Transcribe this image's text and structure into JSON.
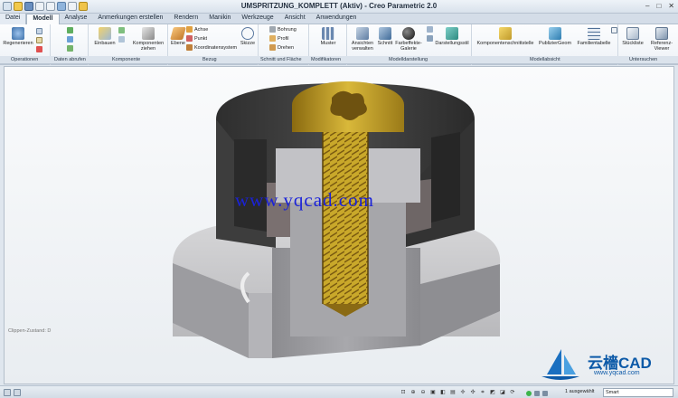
{
  "window": {
    "title": "UMSPRITZUNG_KOMPLETT (Aktiv) - Creo Parametric 2.0",
    "controls": [
      "–",
      "□",
      "✕"
    ]
  },
  "tabs": [
    {
      "label": "Datei",
      "kind": "file"
    },
    {
      "label": "Modell",
      "active": true
    },
    {
      "label": "Analyse"
    },
    {
      "label": "Anmerkungen erstellen"
    },
    {
      "label": "Rendern"
    },
    {
      "label": "Manikin"
    },
    {
      "label": "Werkzeuge"
    },
    {
      "label": "Ansicht"
    },
    {
      "label": "Anwendungen"
    }
  ],
  "ribbon": {
    "operationen": {
      "regenerieren": "Regenerieren",
      "footer": "Operationen"
    },
    "daten": {
      "footer": "Daten abrufen"
    },
    "komponente": {
      "einbauen": "Einbauen",
      "ziehen": "Komponenten ziehen",
      "footer": "Komponente"
    },
    "bezug": {
      "ebene": "Ebene",
      "achse": "Achse",
      "punkt": "Punkt",
      "koordinatensystem": "Koordinatensystem",
      "skizze": "Skizze",
      "footer": "Bezug"
    },
    "schnitt": {
      "bohrung": "Bohrung",
      "profil": "Profil",
      "drehen": "Drehen",
      "footer": "Schnitt und Fläche"
    },
    "modifikatoren": {
      "muster": "Muster",
      "footer": "Modifikatoren"
    },
    "darstellung": {
      "ansichten": "Ansichten verwalten",
      "schnitt": "Schnitt",
      "farbeffekte": "Farbeffekte-Galerie",
      "darstellungsstil": "Darstellungsstil",
      "footer": "Modelldarstellung"
    },
    "absicht": {
      "komponentenschnittstelle": "Komponentenschnittstelle",
      "publiziergeom": "PublizierGeom",
      "familientabelle": "Familientabelle",
      "footer": "Modellabsicht"
    },
    "untersuchen": {
      "stueckliste": "Stückliste",
      "referenz": "Referenz-Viewer",
      "footer": "Untersuchen"
    }
  },
  "viewport": {
    "clip_state": "Clippen-Zustand: D",
    "watermark": "www.yqcad.com",
    "logo_text": "云檣CAD",
    "logo_url": "www.yqcad.com"
  },
  "status": {
    "selection": "1 ausgewählt",
    "filter": "Smart"
  },
  "colors": {
    "housing_dark": "#3a3a3a",
    "base_gray": "#a9a9ab",
    "screw_gold": "#c9a82a",
    "watermark": "#1a22d8",
    "logo": "#0d5aa8"
  }
}
